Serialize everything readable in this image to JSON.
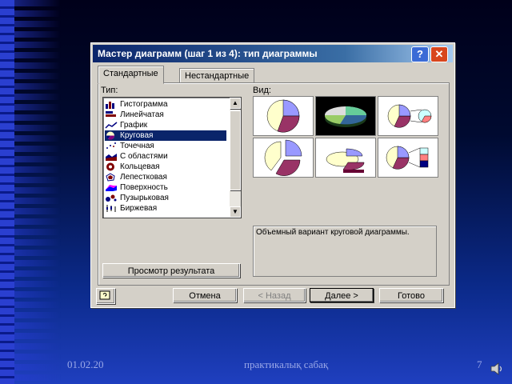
{
  "dialog": {
    "title": "Мастер диаграмм (шаг 1 из 4): тип диаграммы",
    "help": "?",
    "close": "✕",
    "tabs": [
      "Стандартные",
      "Нестандартные"
    ],
    "type_label": "Тип:",
    "view_label": "Вид:",
    "chart_types": [
      {
        "label": "Гистограмма",
        "icon": "column-chart-icon"
      },
      {
        "label": "Линейчатая",
        "icon": "bar-chart-icon"
      },
      {
        "label": "График",
        "icon": "line-chart-icon"
      },
      {
        "label": "Круговая",
        "icon": "pie-chart-icon"
      },
      {
        "label": "Точечная",
        "icon": "scatter-chart-icon"
      },
      {
        "label": "С областями",
        "icon": "area-chart-icon"
      },
      {
        "label": "Кольцевая",
        "icon": "doughnut-chart-icon"
      },
      {
        "label": "Лепестковая",
        "icon": "radar-chart-icon"
      },
      {
        "label": "Поверхность",
        "icon": "surface-chart-icon"
      },
      {
        "label": "Пузырьковая",
        "icon": "bubble-chart-icon"
      },
      {
        "label": "Биржевая",
        "icon": "stock-chart-icon"
      }
    ],
    "selected_type": "Круговая",
    "description": "Объемный вариант круговой диаграммы.",
    "preview_button": "Просмотр результата",
    "buttons": {
      "cancel": "Отмена",
      "back": "< Назад",
      "next": "Далее >",
      "finish": "Готово"
    }
  },
  "footer": {
    "date": "01.02.20",
    "title": "практикалық сабақ",
    "page": "7"
  }
}
